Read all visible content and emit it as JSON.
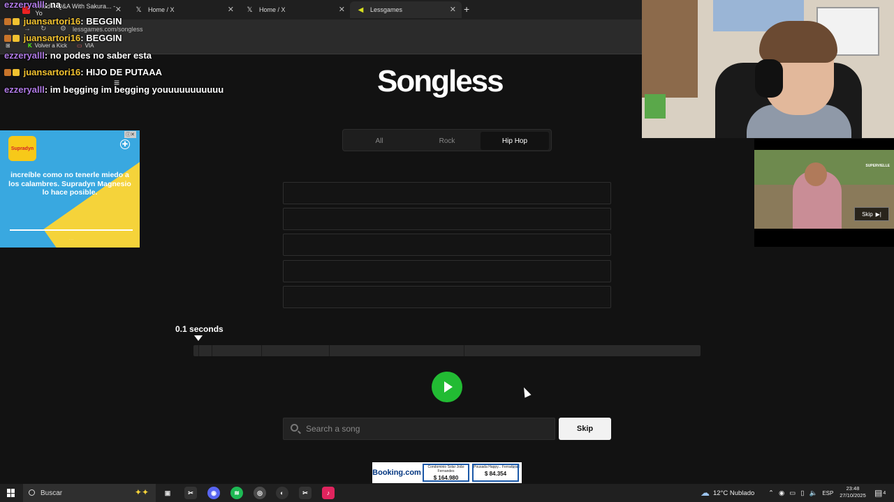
{
  "browser": {
    "tabs": [
      {
        "label": "I Had A Q&A With Sakura... - Yo",
        "icon": "youtube-icon"
      },
      {
        "label": "Home / X",
        "icon": "x-icon"
      },
      {
        "label": "Home / X",
        "icon": "x-icon"
      },
      {
        "label": "Lessgames",
        "icon": "lessgames-icon"
      }
    ],
    "url": "lessgames.com/songless",
    "bookmarks": [
      "Volver a Kick",
      "VIA"
    ]
  },
  "chat": [
    {
      "user": "ezzeryalll",
      "message": ": na",
      "color": "#b07ae6"
    },
    {
      "user": "juansartori16",
      "message": ": BEGGIN",
      "color": "#f2c230"
    },
    {
      "user": "juansartori16",
      "message": ": BEGGIN",
      "color": "#f2c230"
    },
    {
      "user": "ezzeryalll",
      "message": ": no podes no saber esta",
      "color": "#b07ae6"
    },
    {
      "user": "juansartori16",
      "message": ": HIJO DE PUTAAA",
      "color": "#f2c230"
    },
    {
      "user": "ezzeryalll",
      "message": ": im begging im begging youuuuuuuuuuu",
      "color": "#b07ae6"
    }
  ],
  "game": {
    "logo": "Songless",
    "genres": [
      "All",
      "Rock",
      "Hip Hop"
    ],
    "active_genre": "Hip Hop",
    "guess_slots": [
      "",
      "",
      "",
      "",
      ""
    ],
    "duration_label": "0.1 seconds",
    "search_placeholder": "Search a song",
    "skip_label": "Skip",
    "accent": "#22bb33"
  },
  "ads": {
    "left": {
      "brand": "Supradyn",
      "text": "increíble como no tenerle miedo a los calambres. Supradyn Magnesio lo hace posible."
    },
    "video": {
      "brand": "SUPERVIELLE",
      "skip": "Skip"
    },
    "bottom": {
      "brand": "Booking.com",
      "listings": [
        {
          "name": "Condominio Solar João Fernandes",
          "price": "$ 164.980"
        },
        {
          "name": "Pousada Happy... Ferradura",
          "price": "$ 84.354"
        }
      ]
    }
  },
  "taskbar": {
    "search": "Buscar",
    "weather": "12°C  Nublado",
    "lang": "ESP",
    "time": "23:48",
    "date": "27/10/2025",
    "notifications": "4"
  }
}
